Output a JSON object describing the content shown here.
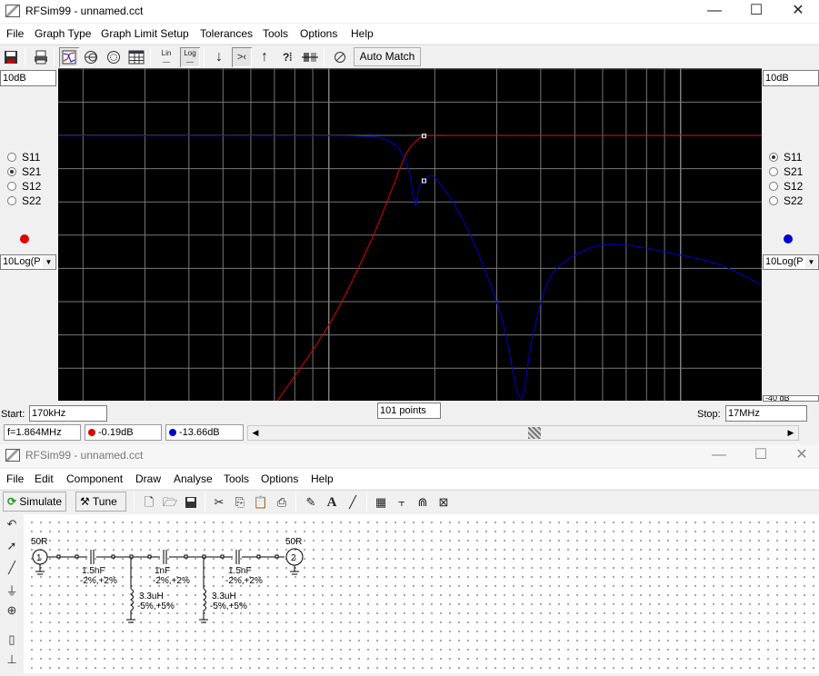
{
  "graph_window": {
    "title": "RFSim99 - unnamed.cct",
    "menu": [
      "File",
      "Graph Type",
      "Graph Limit Setup",
      "Tolerances",
      "Tools",
      "Options",
      "Help"
    ],
    "toolbar": {
      "auto_match_label": "Auto Match",
      "buttons": [
        "save-icon",
        "print-icon",
        "rect-graph-icon",
        "smith-chart-icon",
        "polar-chart-icon",
        "table-icon",
        "linear-scale-icon",
        "log-scale-icon",
        "marker-down-icon",
        "marker-center-icon",
        "marker-up-icon",
        "help-icon",
        "component-icon",
        "reset-icon"
      ],
      "lin_label": "Lin",
      "log_label": "Log",
      "help_label": "?"
    },
    "left_panel": {
      "scale": "10dB",
      "options": [
        "S11",
        "S21",
        "S12",
        "S22"
      ],
      "selected": "S21",
      "trace_color": "#e00000",
      "format": "10Log(P"
    },
    "right_panel": {
      "scale": "10dB",
      "options": [
        "S11",
        "S21",
        "S12",
        "S22"
      ],
      "selected": "S11",
      "trace_color": "#0000cc",
      "format": "10Log(P"
    },
    "bottom": {
      "start_label": "Start:",
      "start_value": "170kHz",
      "points_value": "101 points",
      "stop_label": "Stop:",
      "stop_value": "17MHz",
      "right_scale_truncated": "-40 dB"
    },
    "status": {
      "freq": "f=1.864MHz",
      "s21_value": "-0.19dB",
      "s11_value": "-13.66dB"
    },
    "window_buttons": [
      "—",
      "☐",
      "✕"
    ]
  },
  "chart_data": {
    "type": "line",
    "xscale": "log",
    "xlim": [
      170000,
      17000000
    ],
    "grid": true,
    "background": "#000000",
    "series": [
      {
        "color": "#e00000",
        "label_ref": "S21",
        "x": [
          700000,
          1000000,
          1300000,
          1500000,
          1650000,
          1760000,
          1864000,
          2100000,
          2500000,
          3500000,
          6000000,
          17000000
        ],
        "y": [
          -81,
          -57,
          -33,
          -17,
          -6,
          -2,
          -0.19,
          -0.06,
          -0.03,
          -0.02,
          -0.02,
          -0.02
        ]
      },
      {
        "color": "#0000cc",
        "label_ref": "S11",
        "x": [
          170000,
          800000,
          1000000,
          1200000,
          1400000,
          1550000,
          1640000,
          1700000,
          1760000,
          1800000,
          1864000,
          1950000,
          2050000,
          2250000,
          2600000,
          3100000,
          3500000,
          3800000,
          4300000,
          5500000,
          7000000,
          10000000,
          13000000,
          17000000
        ],
        "y": [
          -0.1,
          -0.1,
          -0.1,
          -0.2,
          -0.7,
          -3,
          -7,
          -12,
          -21,
          -16,
          -13.66,
          -12,
          -14,
          -20,
          -33,
          -55,
          -79,
          -60,
          -42,
          -34,
          -33,
          -36,
          -39,
          -45
        ]
      }
    ]
  },
  "schematic_window": {
    "title": "RFSim99 - unnamed.cct",
    "menu": [
      "File",
      "Edit",
      "Component",
      "Draw",
      "Analyse",
      "Tools",
      "Options",
      "Help"
    ],
    "simulate_label": "Simulate",
    "tune_label": "Tune",
    "text_tool_label": "A",
    "window_buttons": [
      "—",
      "☐",
      "✕"
    ],
    "components": {
      "port1": {
        "number": "1",
        "label": "50R"
      },
      "port2": {
        "number": "2",
        "label": "50R"
      },
      "c1": {
        "value": "1.5nF",
        "tol": "-2%,+2%"
      },
      "c2": {
        "value": "1nF",
        "tol": "-2%,+2%"
      },
      "c3": {
        "value": "1.5nF",
        "tol": "-2%,+2%"
      },
      "l1": {
        "value": "3.3uH",
        "tol": "-5%,+5%"
      },
      "l2": {
        "value": "3.3uH",
        "tol": "-5%,+5%"
      }
    }
  }
}
